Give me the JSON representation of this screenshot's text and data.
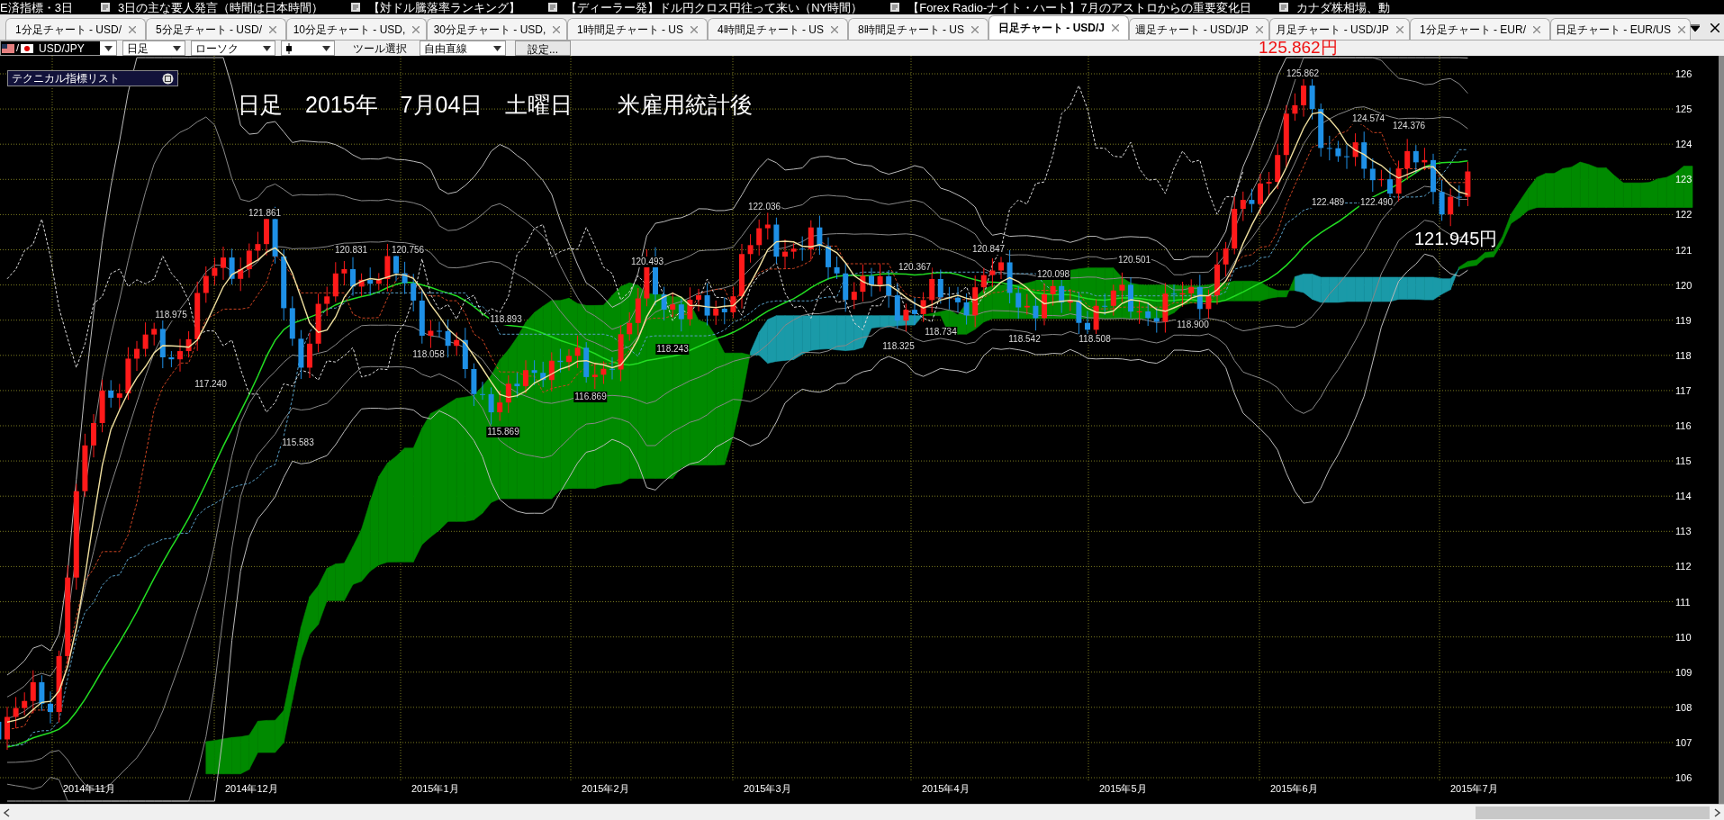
{
  "ticker": [
    "E済指標・3日",
    "3日の主な要人発言（時間は日本時間）",
    "【対ドル騰落率ランキング】",
    "【ディーラー発】ドル円クロス円往って来い（NY時間）",
    "【Forex Radio-ナイト・ハート】7月のアストロからの重要変化日",
    "カナダ株相場、動"
  ],
  "tabs": [
    {
      "label": "1分足チャート - USD/",
      "selected": false
    },
    {
      "label": "5分足チャート - USD/",
      "selected": false
    },
    {
      "label": "10分足チャート - USD,",
      "selected": false
    },
    {
      "label": "30分足チャート - USD,",
      "selected": false
    },
    {
      "label": "1時間足チャート - US",
      "selected": false
    },
    {
      "label": "4時間足チャート - US",
      "selected": false
    },
    {
      "label": "8時間足チャート - US",
      "selected": false
    },
    {
      "label": "日足チャート - USD/J",
      "selected": true
    },
    {
      "label": "週足チャート - USD/JP",
      "selected": false
    },
    {
      "label": "月足チャート - USD/JP",
      "selected": false
    },
    {
      "label": "1分足チャート - EUR/",
      "selected": false
    },
    {
      "label": "日足チャート - EUR/US",
      "selected": false
    }
  ],
  "toolbar": {
    "pair_separator": "/",
    "symbol": "USD/JPY",
    "period": "日足",
    "chart_type": "ローソク",
    "tool_label": "ツール選択",
    "tool": "自由直線",
    "settings_button": "設定...",
    "current_price": "125.862円"
  },
  "chart": {
    "indicator_panel": "テクニカル指標リスト",
    "title": "日足　2015年　7月04日　土曜日　　米雇用統計後",
    "callout": "121.945円",
    "price_labels": [
      "125.862",
      "124.574",
      "124.376",
      "122.489",
      "122.490",
      "122.036",
      "121.861",
      "120.831",
      "120.756",
      "120.493",
      "120.367",
      "120.847",
      "120.098",
      "120.501",
      "118.975",
      "118.893",
      "117.240",
      "118.058",
      "118.243",
      "118.325",
      "118.734",
      "118.542",
      "118.508",
      "118.900",
      "116.869",
      "115.869",
      "115.583"
    ],
    "y_ticks": [
      "126",
      "125",
      "124",
      "123",
      "122",
      "121",
      "120",
      "119",
      "118",
      "117",
      "116",
      "115",
      "114",
      "113",
      "112",
      "111",
      "110",
      "109",
      "108",
      "107",
      "106"
    ],
    "x_labels": [
      "2014年11月",
      "2014年12月",
      "2015年1月",
      "2015年2月",
      "2015年3月",
      "2015年4月",
      "2015年5月",
      "2015年6月",
      "2015年7月"
    ]
  }
}
